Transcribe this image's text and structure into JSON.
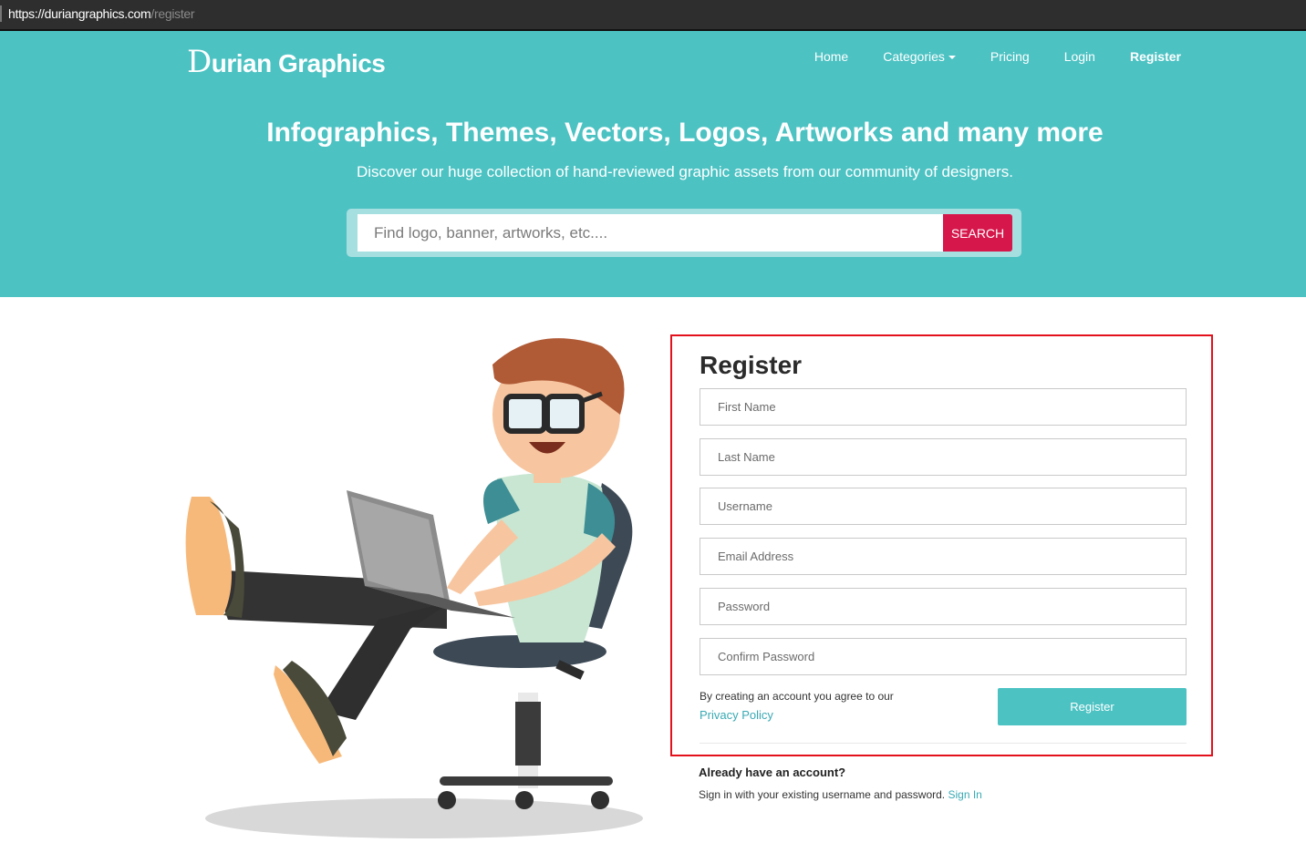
{
  "browser": {
    "url_host": "https://duriangraphics.com",
    "url_path": "/register"
  },
  "header": {
    "logo_initial": "D",
    "logo_rest": "urian Graphics",
    "nav": {
      "home": "Home",
      "categories": "Categories",
      "pricing": "Pricing",
      "login": "Login",
      "register": "Register"
    }
  },
  "hero": {
    "headline": "Infographics, Themes, Vectors, Logos, Artworks and many more",
    "subline": "Discover our huge collection of hand-reviewed graphic assets from our community of designers.",
    "search_placeholder": "Find logo, banner, artworks, etc....",
    "search_button": "SEARCH"
  },
  "register": {
    "title": "Register",
    "first_name_placeholder": "First Name",
    "last_name_placeholder": "Last Name",
    "username_placeholder": "Username",
    "email_placeholder": "Email Address",
    "password_placeholder": "Password",
    "confirm_password_placeholder": "Confirm Password",
    "agree_text": "By creating an account you agree to our",
    "privacy_link": "Privacy Policy",
    "submit_label": "Register"
  },
  "signin": {
    "heading": "Already have an account?",
    "text": "Sign in with your existing username and password.",
    "link": "Sign In"
  },
  "colors": {
    "brand_teal": "#4cc2c3",
    "search_red": "#d6174b",
    "highlight_red": "#e3111b",
    "link_teal": "#3aa9b4"
  }
}
